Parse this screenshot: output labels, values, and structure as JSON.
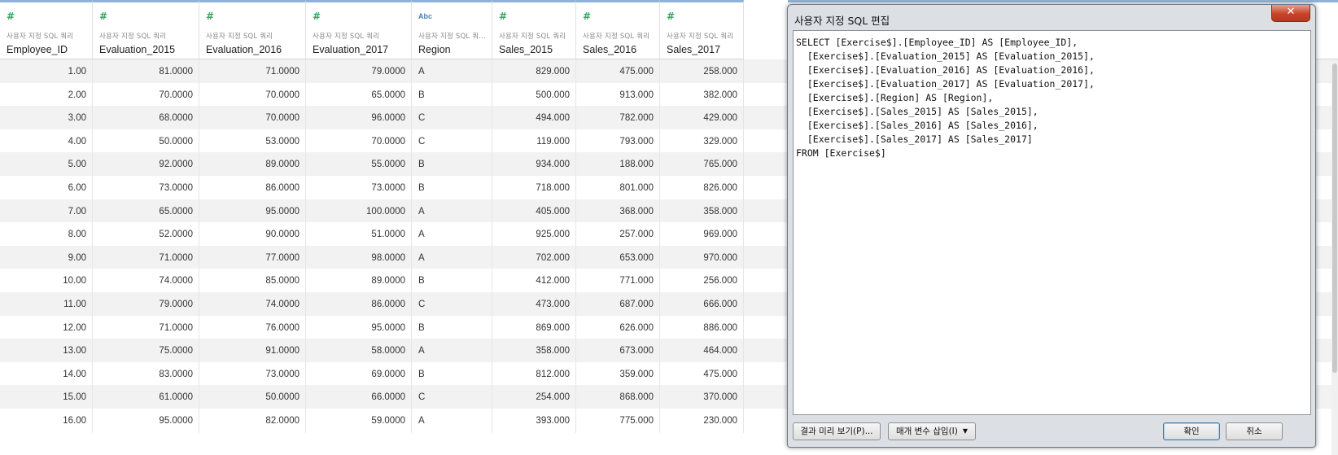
{
  "grid": {
    "columns": [
      {
        "type": "number",
        "type_icon": "#",
        "source": "사용자 지정 SQL 쿼리",
        "name": "Employee_ID",
        "align": "num"
      },
      {
        "type": "number",
        "type_icon": "#",
        "source": "사용자 지정 SQL 쿼리",
        "name": "Evaluation_2015",
        "align": "num"
      },
      {
        "type": "number",
        "type_icon": "#",
        "source": "사용자 지정 SQL 쿼리",
        "name": "Evaluation_2016",
        "align": "num"
      },
      {
        "type": "number",
        "type_icon": "#",
        "source": "사용자 지정 SQL 쿼리",
        "name": "Evaluation_2017",
        "align": "num"
      },
      {
        "type": "string",
        "type_icon": "Abc",
        "source": "사용자 지정 SQL 쿼...",
        "name": "Region",
        "align": "txt"
      },
      {
        "type": "number",
        "type_icon": "#",
        "source": "사용자 지정 SQL 쿼리",
        "name": "Sales_2015",
        "align": "num"
      },
      {
        "type": "number",
        "type_icon": "#",
        "source": "사용자 지정 SQL 쿼리",
        "name": "Sales_2016",
        "align": "num"
      },
      {
        "type": "number",
        "type_icon": "#",
        "source": "사용자 지정 SQL 쿼리",
        "name": "Sales_2017",
        "align": "num"
      }
    ],
    "rows": [
      [
        "1.00",
        "81.0000",
        "71.0000",
        "79.0000",
        "A",
        "829.000",
        "475.000",
        "258.000"
      ],
      [
        "2.00",
        "70.0000",
        "70.0000",
        "65.0000",
        "B",
        "500.000",
        "913.000",
        "382.000"
      ],
      [
        "3.00",
        "68.0000",
        "70.0000",
        "96.0000",
        "C",
        "494.000",
        "782.000",
        "429.000"
      ],
      [
        "4.00",
        "50.0000",
        "53.0000",
        "70.0000",
        "C",
        "119.000",
        "793.000",
        "329.000"
      ],
      [
        "5.00",
        "92.0000",
        "89.0000",
        "55.0000",
        "B",
        "934.000",
        "188.000",
        "765.000"
      ],
      [
        "6.00",
        "73.0000",
        "86.0000",
        "73.0000",
        "B",
        "718.000",
        "801.000",
        "826.000"
      ],
      [
        "7.00",
        "65.0000",
        "95.0000",
        "100.0000",
        "A",
        "405.000",
        "368.000",
        "358.000"
      ],
      [
        "8.00",
        "52.0000",
        "90.0000",
        "51.0000",
        "A",
        "925.000",
        "257.000",
        "969.000"
      ],
      [
        "9.00",
        "71.0000",
        "77.0000",
        "98.0000",
        "A",
        "702.000",
        "653.000",
        "970.000"
      ],
      [
        "10.00",
        "74.0000",
        "85.0000",
        "89.0000",
        "B",
        "412.000",
        "771.000",
        "256.000"
      ],
      [
        "11.00",
        "79.0000",
        "74.0000",
        "86.0000",
        "C",
        "473.000",
        "687.000",
        "666.000"
      ],
      [
        "12.00",
        "71.0000",
        "76.0000",
        "95.0000",
        "B",
        "869.000",
        "626.000",
        "886.000"
      ],
      [
        "13.00",
        "75.0000",
        "91.0000",
        "58.0000",
        "A",
        "358.000",
        "673.000",
        "464.000"
      ],
      [
        "14.00",
        "83.0000",
        "73.0000",
        "69.0000",
        "B",
        "812.000",
        "359.000",
        "475.000"
      ],
      [
        "15.00",
        "61.0000",
        "50.0000",
        "66.0000",
        "C",
        "254.000",
        "868.000",
        "370.000"
      ],
      [
        "16.00",
        "95.0000",
        "82.0000",
        "59.0000",
        "A",
        "393.000",
        "775.000",
        "230.000"
      ]
    ]
  },
  "dialog": {
    "title": "사용자 지정 SQL 편집",
    "close_icon": "close-icon",
    "close_glyph": "✕",
    "sql_lines": [
      "SELECT [Exercise$].[Employee_ID] AS [Employee_ID],",
      "  [Exercise$].[Evaluation_2015] AS [Evaluation_2015],",
      "  [Exercise$].[Evaluation_2016] AS [Evaluation_2016],",
      "  [Exercise$].[Evaluation_2017] AS [Evaluation_2017],",
      "  [Exercise$].[Region] AS [Region],",
      "  [Exercise$].[Sales_2015] AS [Sales_2015],",
      "  [Exercise$].[Sales_2016] AS [Sales_2016],",
      "  [Exercise$].[Sales_2017] AS [Sales_2017]",
      "FROM [Exercise$]"
    ],
    "preview_button": "결과 미리 보기(P)...",
    "insert_param_button": "매개 변수 삽입(I)",
    "insert_param_caret": "▼",
    "ok_button": "확인",
    "cancel_button": "취소"
  },
  "colors": {
    "number_icon": "#3aa25f",
    "string_icon": "#4a7fb5",
    "header_accent": "#8fb3d6",
    "close_button": "#c7432a"
  }
}
